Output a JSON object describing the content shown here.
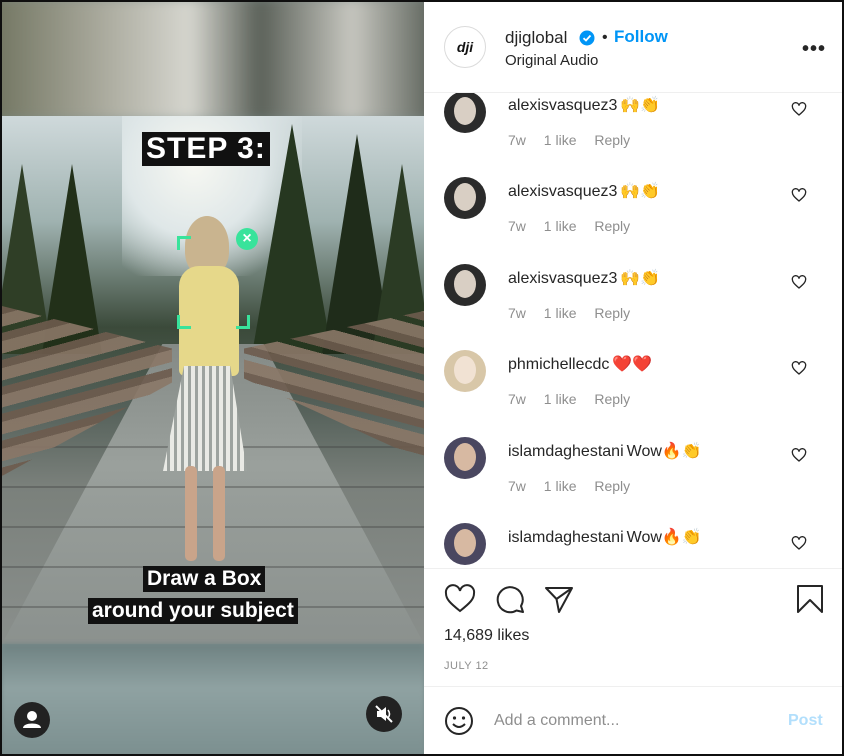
{
  "media": {
    "step_text": "STEP 3:",
    "caption_line1": "Draw a Box",
    "caption_line2": "around your subject"
  },
  "header": {
    "logo_text": "dji",
    "username": "djiglobal",
    "separator": "•",
    "follow_label": "Follow",
    "audio_label": "Original Audio",
    "more_label": "•••"
  },
  "comments": [
    {
      "user": "alexisvasquez3",
      "text": "🙌👏",
      "time": "7w",
      "likes": "1 like",
      "reply": "Reply"
    },
    {
      "user": "alexisvasquez3",
      "text": "🙌👏",
      "time": "7w",
      "likes": "1 like",
      "reply": "Reply"
    },
    {
      "user": "alexisvasquez3",
      "text": "🙌👏",
      "time": "7w",
      "likes": "1 like",
      "reply": "Reply"
    },
    {
      "user": "phmichellecdc",
      "text": "❤️❤️",
      "time": "7w",
      "likes": "1 like",
      "reply": "Reply"
    },
    {
      "user": "islamdaghestani",
      "text": "Wow🔥👏",
      "time": "7w",
      "likes": "1 like",
      "reply": "Reply"
    },
    {
      "user": "islamdaghestani",
      "text": "Wow🔥👏",
      "time": "",
      "likes": "",
      "reply": ""
    }
  ],
  "footer": {
    "likes_count": "14,689 likes",
    "date": "JULY 12",
    "comment_placeholder": "Add a comment...",
    "post_label": "Post"
  },
  "colors": {
    "accent_blue": "#0095f6",
    "post_disabled": "#b2dffc",
    "tracking_green": "#39e39b"
  }
}
